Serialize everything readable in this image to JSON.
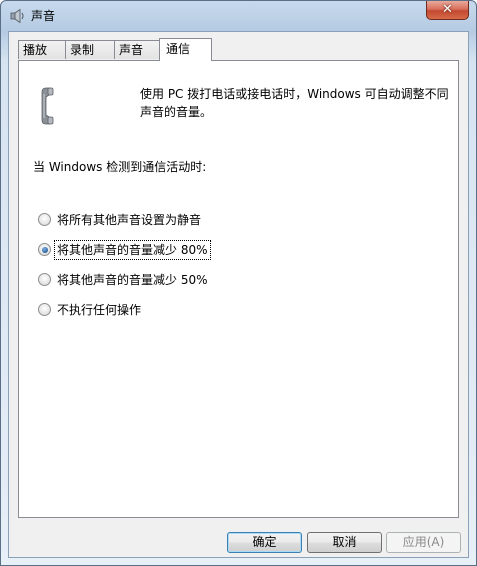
{
  "window": {
    "title": "声音",
    "close_label": "✕"
  },
  "tabs": [
    {
      "label": "播放",
      "active": false
    },
    {
      "label": "录制",
      "active": false
    },
    {
      "label": "声音",
      "active": false
    },
    {
      "label": "通信",
      "active": true
    }
  ],
  "panel": {
    "icon": "telephone-handset-icon",
    "description": "使用 PC 拨打电话或接电话时，Windows 可自动调整不同声音的音量。",
    "heading": "当 Windows 检测到通信活动时:",
    "options": [
      {
        "label": "将所有其他声音设置为静音",
        "checked": false
      },
      {
        "label": "将其他声音的音量减少 80%",
        "checked": true
      },
      {
        "label": "将其他声音的音量减少 50%",
        "checked": false
      },
      {
        "label": "不执行任何操作",
        "checked": false
      }
    ]
  },
  "buttons": {
    "ok": "确定",
    "cancel": "取消",
    "apply": "应用(A)"
  }
}
